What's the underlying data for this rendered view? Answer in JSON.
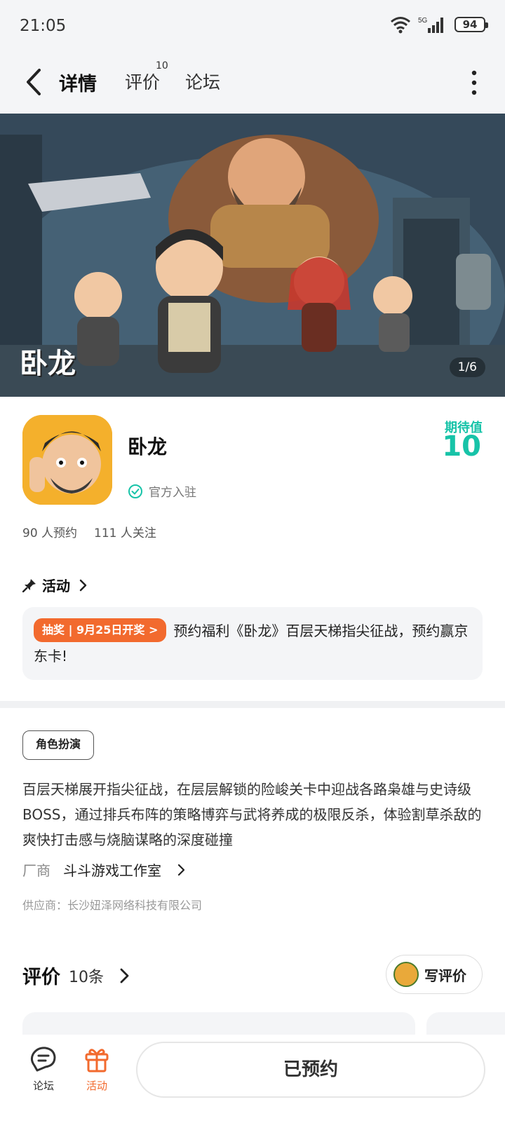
{
  "status_bar": {
    "time": "21:05",
    "network": "5G",
    "battery": "94"
  },
  "nav": {
    "tabs": [
      {
        "label": "详情",
        "active": true
      },
      {
        "label": "评价",
        "badge": "10"
      },
      {
        "label": "论坛"
      }
    ]
  },
  "hero": {
    "logo_text": "卧龙",
    "counter": "1/6"
  },
  "app": {
    "name": "卧龙",
    "official_label": "官方入驻",
    "expect_label": "期待值",
    "expect_value": "10",
    "reservations": "90 人预约",
    "followers": "111 人关注"
  },
  "activity": {
    "title": "活动",
    "badge": "抽奖 | 9月25日开奖 >",
    "text": "预约福利《卧龙》百层天梯指尖征战，预约赢京东卡!"
  },
  "details": {
    "genre_tag": "角色扮演",
    "description": "百层天梯展开指尖征战，在层层解锁的险峻关卡中迎战各路枭雄与史诗级BOSS，通过排兵布阵的策略博弈与武将养成的极限反杀，体验割草杀敌的爽快打击感与烧脑谋略的深度碰撞",
    "developer_label": "厂商",
    "developer_name": "斗斗游戏工作室",
    "supplier": "供应商：长沙妞泽网络科技有限公司"
  },
  "reviews": {
    "title": "评价",
    "count": "10条",
    "write_button": "写评价"
  },
  "bottom_nav": {
    "forum_label": "论坛",
    "activity_label": "活动",
    "reserve_button": "已预约"
  },
  "colors": {
    "accent": "#17c3a8",
    "highlight": "#19d6b5",
    "orange": "#f26a2e"
  }
}
